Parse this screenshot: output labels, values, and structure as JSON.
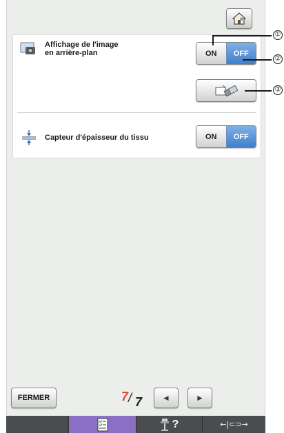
{
  "header": {
    "home_icon": "home-icon"
  },
  "settings": [
    {
      "label_line1": "Affichage de l'image",
      "label_line2": "en arrière-plan",
      "icon": "camera-image-icon",
      "on_label": "ON",
      "off_label": "OFF",
      "state": "OFF"
    },
    {
      "label_line1": "Capteur d'épaisseur du tissu",
      "icon": "thickness-sensor-icon",
      "on_label": "ON",
      "off_label": "OFF",
      "state": "OFF"
    }
  ],
  "erase_button": {
    "icon": "eraser-icon"
  },
  "callouts": [
    "①",
    "②",
    "③"
  ],
  "footer": {
    "close_label": "FERMER",
    "page_current": "7",
    "page_total": "7",
    "prev_icon": "left-arrow-icon",
    "next_icon": "right-arrow-icon",
    "prev_glyph": "◄",
    "next_glyph": "►"
  },
  "bottom_bar": {
    "items": [
      {
        "icon": "blank-icon"
      },
      {
        "icon": "settings-list-icon"
      },
      {
        "icon": "help-icon",
        "glyph": "?"
      },
      {
        "icon": "width-adjust-icon",
        "glyph": "←|⊂⊃→"
      }
    ],
    "active_color": "#8a6fc4"
  },
  "colors": {
    "accent": "#3f7fcb",
    "page_current": "#e0452e"
  }
}
